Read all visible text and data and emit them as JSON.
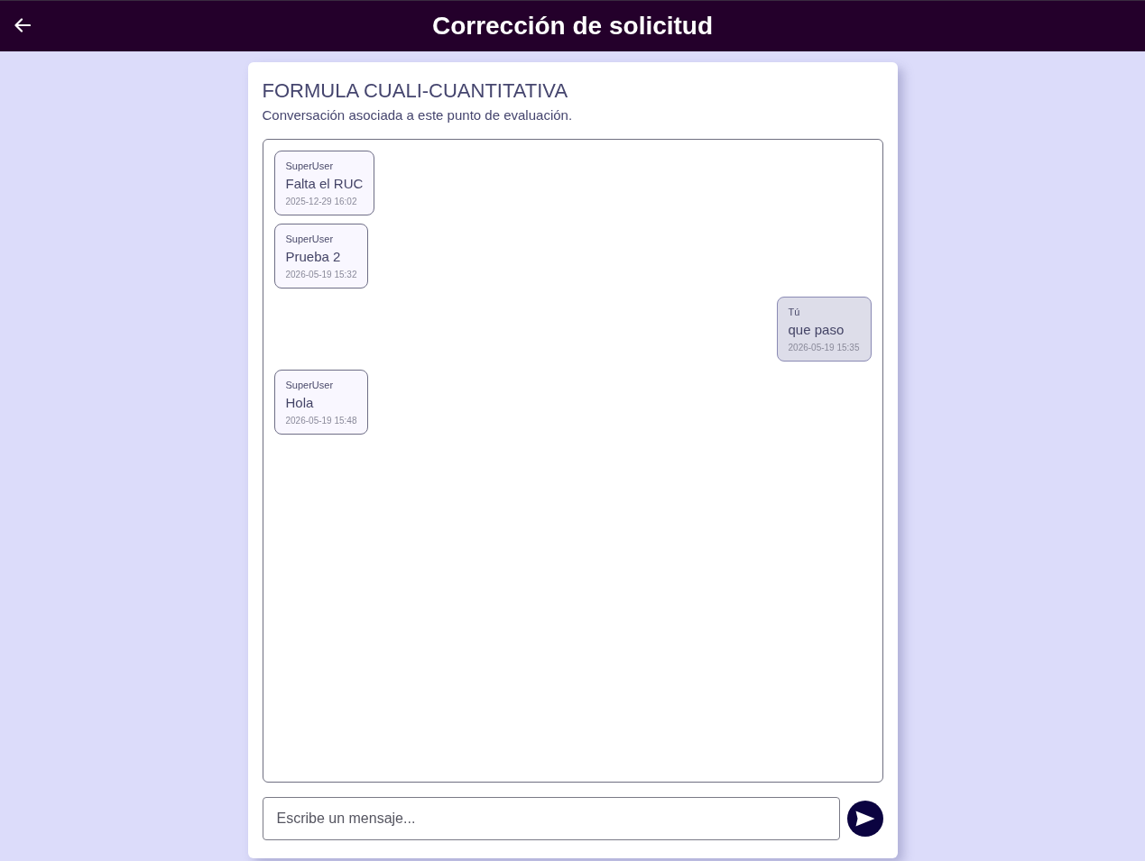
{
  "header": {
    "title": "Corrección de solicitud"
  },
  "card": {
    "title": "FORMULA CUALI-CUANTITATIVA",
    "subtitle": "Conversación asociada a este punto de evaluación."
  },
  "messages": [
    {
      "kind": "incoming",
      "sender": "SuperUser",
      "text": "Falta el RUC",
      "time": "2025-12-29 16:02"
    },
    {
      "kind": "incoming",
      "sender": "SuperUser",
      "text": "Prueba 2",
      "time": "2026-05-19 15:32"
    },
    {
      "kind": "outgoing",
      "sender": "Tú",
      "text": "que paso",
      "time": "2026-05-19 15:35"
    },
    {
      "kind": "incoming",
      "sender": "SuperUser",
      "text": "Hola",
      "time": "2026-05-19 15:48"
    }
  ],
  "composer": {
    "placeholder": "Escribe un mensaje..."
  }
}
